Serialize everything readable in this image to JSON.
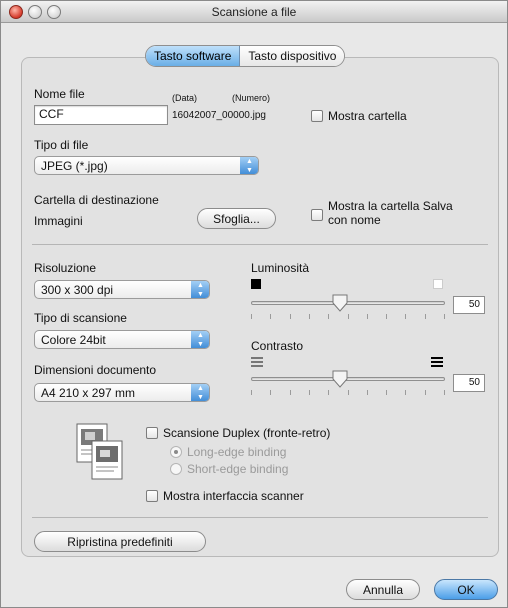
{
  "window": {
    "title": "Scansione a file"
  },
  "tabs": [
    {
      "label": "Tasto software",
      "active": true
    },
    {
      "label": "Tasto dispositivo",
      "active": false
    }
  ],
  "file": {
    "name_label": "Nome file",
    "name_value": "CCF",
    "data_label": "(Data)",
    "number_label": "(Numero)",
    "generated_name": "16042007_00000.jpg",
    "show_folder_label": "Mostra cartella",
    "show_folder_checked": false
  },
  "file_type": {
    "label": "Tipo di file",
    "selected": "JPEG (*.jpg)"
  },
  "destination": {
    "label": "Cartella di destinazione",
    "folder": "Immagini",
    "browse_label": "Sfoglia...",
    "save_as_label_line1": "Mostra la cartella Salva",
    "save_as_label_line2": "con nome",
    "save_as_checked": false
  },
  "resolution": {
    "label": "Risoluzione",
    "selected": "300 x 300 dpi"
  },
  "scan_type": {
    "label": "Tipo di scansione",
    "selected": "Colore 24bit"
  },
  "document_size": {
    "label": "Dimensioni documento",
    "selected": "A4  210 x 297 mm"
  },
  "brightness": {
    "label": "Luminosità",
    "value": "50",
    "level": 50,
    "min_icon": "black-square-icon",
    "max_icon": "white-square-icon"
  },
  "contrast": {
    "label": "Contrasto",
    "value": "50",
    "level": 50,
    "min_icon": "contrast-low-icon",
    "max_icon": "contrast-high-icon"
  },
  "duplex": {
    "icon": "duplex-pages-icon",
    "label": "Scansione Duplex (fronte-retro)",
    "checked": false,
    "options": [
      {
        "label": "Long-edge binding",
        "selected": true
      },
      {
        "label": "Short-edge binding",
        "selected": false
      }
    ]
  },
  "scanner_interface": {
    "label": "Mostra interfaccia scanner",
    "checked": false
  },
  "reset_label": "Ripristina predefiniti",
  "footer": {
    "cancel_label": "Annulla",
    "ok_label": "OK"
  },
  "colors": {
    "accent": "#4b9ee8",
    "window_bg": "#e8e8e8",
    "panel_bg": "#e2e2e2"
  }
}
